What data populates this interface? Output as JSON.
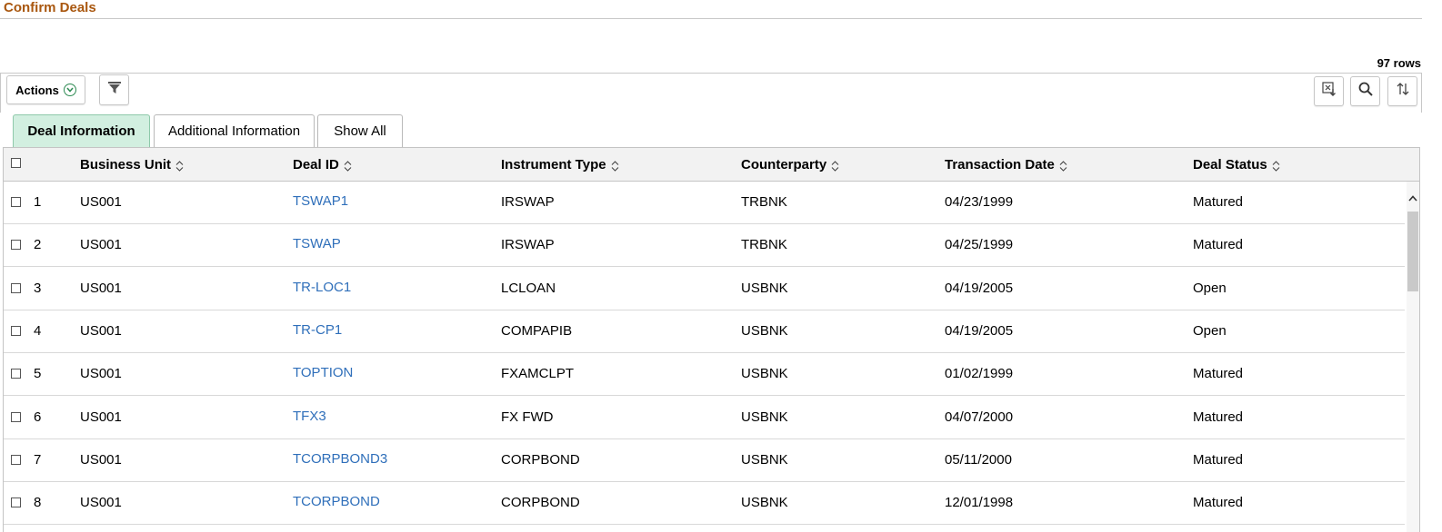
{
  "page": {
    "title": "Confirm Deals",
    "row_count": "97 rows"
  },
  "toolbar": {
    "actions_label": "Actions",
    "icons": {
      "actions": "chevron-down-circle-icon",
      "filter": "filter-icon",
      "export": "excel-export-icon",
      "search": "search-icon",
      "sort": "sort-icon"
    }
  },
  "tabs": [
    {
      "label": "Deal Information",
      "active": true
    },
    {
      "label": "Additional Information",
      "active": false
    },
    {
      "label": "Show All",
      "active": false
    }
  ],
  "grid": {
    "columns": [
      {
        "label": "Business Unit"
      },
      {
        "label": "Deal ID"
      },
      {
        "label": "Instrument Type"
      },
      {
        "label": "Counterparty"
      },
      {
        "label": "Transaction Date"
      },
      {
        "label": "Deal Status"
      }
    ],
    "rows": [
      {
        "num": "1",
        "business_unit": "US001",
        "deal_id": "TSWAP1",
        "instrument_type": "IRSWAP",
        "counterparty": "TRBNK",
        "transaction_date": "04/23/1999",
        "deal_status": "Matured"
      },
      {
        "num": "2",
        "business_unit": "US001",
        "deal_id": "TSWAP",
        "instrument_type": "IRSWAP",
        "counterparty": "TRBNK",
        "transaction_date": "04/25/1999",
        "deal_status": "Matured"
      },
      {
        "num": "3",
        "business_unit": "US001",
        "deal_id": "TR-LOC1",
        "instrument_type": "LCLOAN",
        "counterparty": "USBNK",
        "transaction_date": "04/19/2005",
        "deal_status": "Open"
      },
      {
        "num": "4",
        "business_unit": "US001",
        "deal_id": "TR-CP1",
        "instrument_type": "COMPAPIB",
        "counterparty": "USBNK",
        "transaction_date": "04/19/2005",
        "deal_status": "Open"
      },
      {
        "num": "5",
        "business_unit": "US001",
        "deal_id": "TOPTION",
        "instrument_type": "FXAMCLPT",
        "counterparty": "USBNK",
        "transaction_date": "01/02/1999",
        "deal_status": "Matured"
      },
      {
        "num": "6",
        "business_unit": "US001",
        "deal_id": "TFX3",
        "instrument_type": "FX FWD",
        "counterparty": "USBNK",
        "transaction_date": "04/07/2000",
        "deal_status": "Matured"
      },
      {
        "num": "7",
        "business_unit": "US001",
        "deal_id": "TCORPBOND3",
        "instrument_type": "CORPBOND",
        "counterparty": "USBNK",
        "transaction_date": "05/11/2000",
        "deal_status": "Matured"
      },
      {
        "num": "8",
        "business_unit": "US001",
        "deal_id": "TCORPBOND",
        "instrument_type": "CORPBOND",
        "counterparty": "USBNK",
        "transaction_date": "12/01/1998",
        "deal_status": "Matured"
      }
    ]
  },
  "colors": {
    "title": "#a9570f",
    "link": "#2f6fba",
    "active_tab": "#d2efe0",
    "accent_green": "#2d8a52"
  }
}
